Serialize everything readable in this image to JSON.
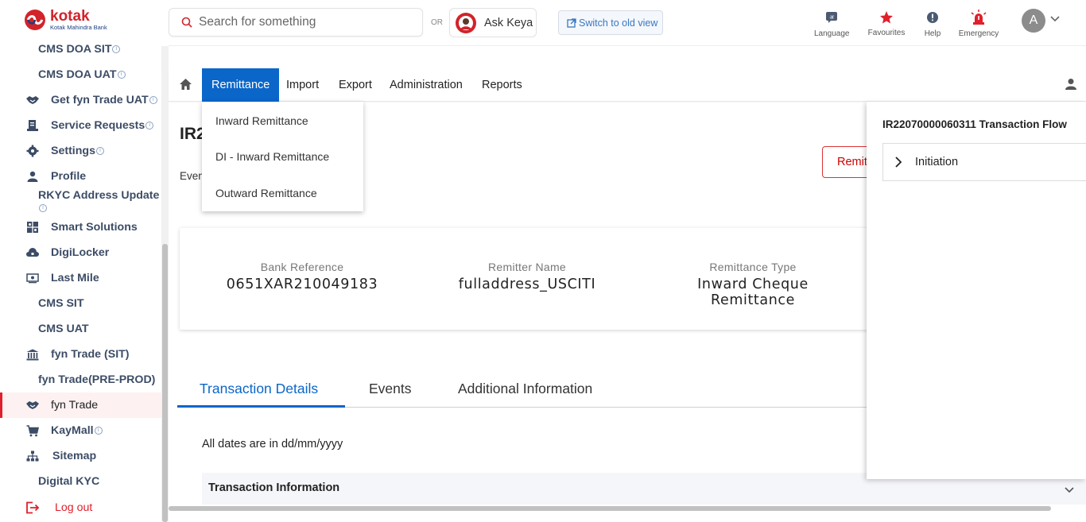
{
  "header": {
    "logo_name": "kotak",
    "logo_sub": "Kotak Mahindra Bank",
    "search_placeholder": "Search for something",
    "or_label": "OR",
    "ask_label": "Ask Keya",
    "switch_label": "Switch to old view",
    "tools": [
      {
        "label": "Language",
        "icon": "language-icon"
      },
      {
        "label": "Favourites",
        "icon": "star-icon"
      },
      {
        "label": "Help",
        "icon": "help-icon"
      },
      {
        "label": "Emergency",
        "icon": "alarm-icon"
      }
    ],
    "avatar_letter": "A"
  },
  "sidebar": {
    "items": [
      {
        "label": "CMS DOA SIT",
        "icon": "",
        "info": true
      },
      {
        "label": "CMS DOA UAT",
        "icon": "",
        "info": true
      },
      {
        "label": "Get fyn Trade UAT",
        "icon": "handshake-icon",
        "info": true
      },
      {
        "label": "Service Requests",
        "icon": "service-icon",
        "info": true
      },
      {
        "label": "Settings",
        "icon": "gear-icon",
        "info": true
      },
      {
        "label": "Profile",
        "icon": "person-icon",
        "info": false
      },
      {
        "label": "RKYC Address Update",
        "icon": "",
        "info": true
      },
      {
        "label": "Smart Solutions",
        "icon": "grid-icon",
        "info": false
      },
      {
        "label": "DigiLocker",
        "icon": "cloud-lock-icon",
        "info": false
      },
      {
        "label": "Last Mile",
        "icon": "cash-icon",
        "info": false
      },
      {
        "label": "CMS SIT",
        "icon": "",
        "info": false
      },
      {
        "label": "CMS UAT",
        "icon": "",
        "info": false
      },
      {
        "label": "fyn Trade (SIT)",
        "icon": "bank-icon",
        "info": false
      },
      {
        "label": "fyn Trade(PRE-PROD)",
        "icon": "",
        "info": false
      },
      {
        "label": "fyn Trade",
        "icon": "handshake-icon",
        "info": false,
        "active": true
      },
      {
        "label": "KayMall",
        "icon": "cart-icon",
        "info": true
      },
      {
        "label": "Sitemap",
        "icon": "sitemap-icon",
        "info": false
      },
      {
        "label": "Digital KYC",
        "icon": "",
        "info": false
      },
      {
        "label": "Log out",
        "icon": "logout-icon",
        "info": false
      }
    ]
  },
  "nav": {
    "items": [
      "Remittance",
      "Import",
      "Export",
      "Administration",
      "Reports"
    ],
    "active": "Remittance"
  },
  "dropdown": {
    "items": [
      "Inward Remittance",
      "DI - Inward Remittance",
      "Outward Remittance"
    ]
  },
  "page": {
    "title_partial": "IR2",
    "events_partial": "Even",
    "remit_button_partial": "Remit"
  },
  "summary": {
    "fields": [
      {
        "label": "Bank Reference",
        "value": "0651XAR210049183"
      },
      {
        "label": "Remitter Name",
        "value": "fulladdress_USCITI"
      },
      {
        "label": "Remittance Type",
        "value": "Inward Cheque Remittance"
      }
    ]
  },
  "tabs": {
    "items": [
      "Transaction Details",
      "Events",
      "Additional Information"
    ],
    "active": "Transaction Details"
  },
  "dates_note": "All dates are in dd/mm/yyyy",
  "section_title": "Transaction Information",
  "flow_panel": {
    "title": "IR22070000060311 Transaction Flow",
    "steps": [
      "Initiation"
    ]
  },
  "colors": {
    "brand_red": "#d2232a",
    "brand_blue": "#1a3f80",
    "nav_active": "#0a66c9",
    "sidebar_text": "#3c4c66"
  }
}
